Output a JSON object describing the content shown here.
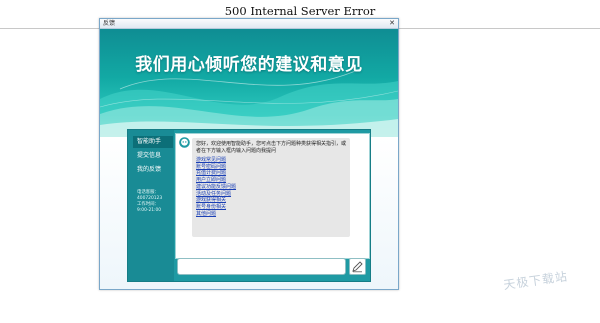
{
  "page": {
    "error_title": "500 Internal Server Error"
  },
  "window": {
    "title": "反馈",
    "close_glyph": "✕"
  },
  "banner": {
    "headline": "我们用心倾听您的建议和意见"
  },
  "sidebar": {
    "items": [
      {
        "label": "智能助手",
        "active": true
      },
      {
        "label": "提交信息",
        "active": false
      },
      {
        "label": "我的反馈",
        "active": false
      }
    ],
    "contact_lines": [
      "电话客服：",
      "400720123",
      "工作时间：",
      "9:00-21:00"
    ]
  },
  "chat": {
    "greeting": "您好，欢迎使用智能助手，您可点击下方问题种类获得相关指引，或者在下方输入框内输入问题向我提问",
    "links": [
      "游戏常见问题",
      "账号密码问题",
      "充值计费问题",
      "用户立即问题",
      "建议功能反馈问题",
      "活动及任务问题",
      "游戏获得相关",
      "账号身份相关",
      "其他问题"
    ]
  },
  "icons": {
    "robot": "robot-avatar-icon",
    "send": "pen-icon"
  },
  "watermark": "天极下载站",
  "colors": {
    "teal": "#1f9aa3",
    "link": "#1a3fb5"
  }
}
